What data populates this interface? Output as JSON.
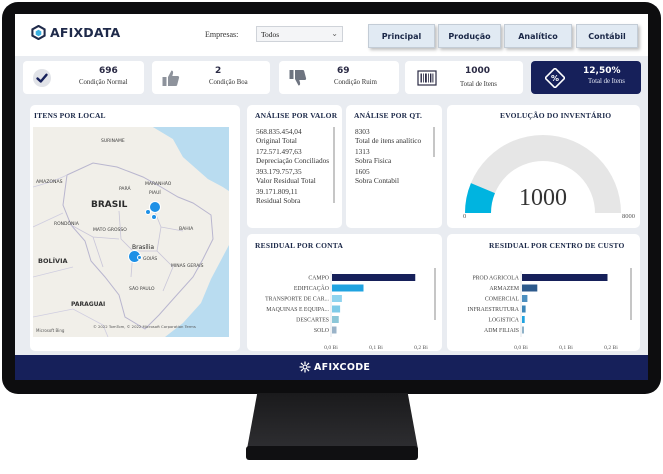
{
  "header": {
    "brand": "AFIXDATA",
    "empresa_label": "Empresas:",
    "empresa_value": "Todos",
    "tabs": [
      "Principal",
      "Produção",
      "Analítico",
      "Contábil"
    ]
  },
  "kpis": [
    {
      "value": "696",
      "label": "Condição Normal",
      "icon": "check-circle-icon"
    },
    {
      "value": "2",
      "label": "Condição Boa",
      "icon": "thumbs-up-icon"
    },
    {
      "value": "69",
      "label": "Condição Ruim",
      "icon": "thumbs-down-icon"
    },
    {
      "value": "1000",
      "label": "Total de Itens",
      "icon": "barcode-icon"
    },
    {
      "value": "12,50%",
      "label": "Total de Itens",
      "icon": "percent-icon"
    }
  ],
  "map_panel": {
    "title": "ITENS POR LOCAL",
    "labels": {
      "suriname": "SURINAME",
      "amazonas": "AMAZONAS",
      "maranhao": "MARANHÃO",
      "piaui": "PIAUÍ",
      "para": "PARÁ",
      "brasil": "BRASIL",
      "rondonia": "RONDÔNIA",
      "mato_grosso": "MATO GROSSO",
      "bahia": "BAHIA",
      "bolivia": "BOLÍVIA",
      "brasilia": "Brasília",
      "goias": "GOIÁS",
      "minas": "MINAS GERAIS",
      "sao_paulo": "SÃO PAULO",
      "paraguai": "PARAGUAI"
    },
    "attribution": "© 2022 TomTom, © 2022 Microsoft Corporation Terms",
    "bing": "Microsoft Bing"
  },
  "analise_valor": {
    "title": "ANÁLISE POR VALOR",
    "rows": [
      {
        "value": "568.835.454,04",
        "label": "Original Total"
      },
      {
        "value": "172.571.497,63",
        "label": "Depreciação Conciliados"
      },
      {
        "value": "393.179.757,35",
        "label": "Valor Residual Total"
      },
      {
        "value": "39.171.809,11",
        "label": "Residual Sobra"
      }
    ]
  },
  "analise_qt": {
    "title": "ANÁLISE POR QT.",
    "rows": [
      {
        "value": "8303",
        "label": "Total de itens analítico"
      },
      {
        "value": "1313",
        "label": "Sobra Fisica"
      },
      {
        "value": "1605",
        "label": "Sobra Contabil"
      }
    ]
  },
  "gauge": {
    "title": "EVOLUÇÃO DO INVENTÁRIO",
    "value": "1000",
    "min": "0",
    "max": "8000",
    "fill_fraction": 0.125
  },
  "residual_conta": {
    "title": "RESIDUAL POR CONTA",
    "axis": [
      "0,0 Bi",
      "0,1 Bi",
      "0,2 Bi"
    ]
  },
  "residual_centro": {
    "title": "RESIDUAL POR CENTRO DE CUSTO",
    "axis": [
      "0,0 Bi",
      "0,1 Bi",
      "0,2 Bi"
    ]
  },
  "chart_data": [
    {
      "type": "bar",
      "orientation": "horizontal",
      "title": "RESIDUAL POR CONTA",
      "categories": [
        "CAMPO",
        "EDIFICAÇÃO",
        "TRANSPORTE DE CAR...",
        "MAQUINAS E EQUIPA...",
        "DESCARTES",
        "SOLO"
      ],
      "values": [
        0.185,
        0.07,
        0.022,
        0.018,
        0.015,
        0.01
      ],
      "xlim": [
        0,
        0.2
      ],
      "xlabel": "",
      "ylabel": "",
      "colors": [
        "#16205a",
        "#1fa3e0",
        "#8fd3ee",
        "#7fcbe8",
        "#8cc7d8",
        "#9ab3c8"
      ]
    },
    {
      "type": "bar",
      "orientation": "horizontal",
      "title": "RESIDUAL POR CENTRO DE CUSTO",
      "categories": [
        "PROD AGRICOLA",
        "ARMAZEM",
        "COMERCIAL",
        "INFRAESTRUTURA",
        "LOGISTICA",
        "ADM FILIAIS"
      ],
      "values": [
        0.19,
        0.034,
        0.012,
        0.008,
        0.006,
        0.003
      ],
      "xlim": [
        0,
        0.2
      ],
      "xlabel": "",
      "ylabel": "",
      "colors": [
        "#16205a",
        "#2d5a8c",
        "#4d8fbf",
        "#3d86b8",
        "#1fa3e0",
        "#8fb2c8"
      ]
    }
  ],
  "footer": {
    "brand": "AFIXCODE"
  },
  "colors": {
    "navy": "#16205a",
    "cyan": "#00b4e0",
    "gauge_track": "#e6e6e6"
  }
}
